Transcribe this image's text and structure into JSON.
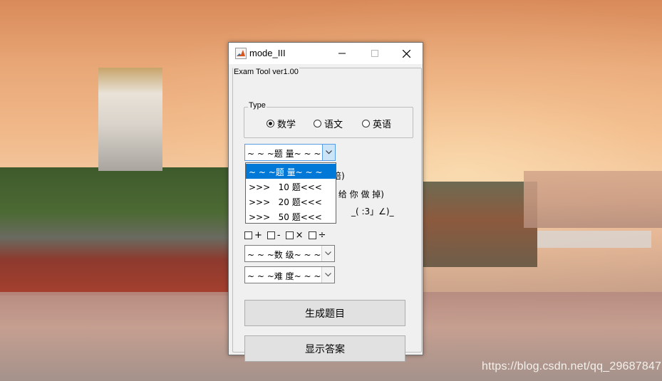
{
  "window": {
    "title": "mode_III",
    "group_title": "Exam Tool ver1.00"
  },
  "type_group": {
    "label": "Type",
    "options": [
      {
        "label": "数学",
        "selected": true
      },
      {
        "label": "语文",
        "selected": false
      },
      {
        "label": "英语",
        "selected": false
      }
    ]
  },
  "count_combo": {
    "value": "~ ~ ~题 量~ ~ ~",
    "options": [
      "~ ~ ~题 量~ ~ ~",
      ">>>   10 题<<<",
      ">>>   20 题<<<",
      ">>>   50 题<<<"
    ],
    "selected_index": 0
  },
  "partial_text": {
    "line1": "翻倍)",
    "line2": "都 给 你 做 掉)",
    "line3": "_( :3」∠)_"
  },
  "operators": [
    "+",
    "-",
    "×",
    "÷"
  ],
  "level_combo": {
    "value": "~ ~ ~数 级~ ~ ~"
  },
  "difficulty_combo": {
    "value": "~ ~ ~难 度~ ~ ~"
  },
  "buttons": {
    "generate": "生成题目",
    "show_answer": "显示答案"
  },
  "watermark": "https://blog.csdn.net/qq_29687847",
  "colors": {
    "selection": "#0078d7",
    "combo_focus": "#569de5",
    "button_face": "#e1e1e1"
  }
}
